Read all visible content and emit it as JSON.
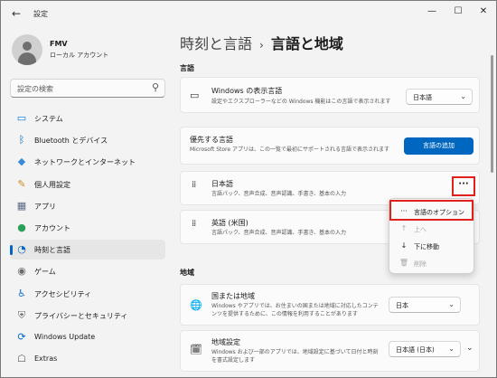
{
  "window": {
    "title": "設定"
  },
  "user": {
    "name": "FMV",
    "account": "ローカル アカウント"
  },
  "search": {
    "placeholder": "設定の検索"
  },
  "nav": [
    {
      "label": "システム",
      "icon": "monitor-icon",
      "color": "#0078d4"
    },
    {
      "label": "Bluetooth とデバイス",
      "icon": "bluetooth-icon",
      "color": "#0067c0"
    },
    {
      "label": "ネットワークとインターネット",
      "icon": "wifi-icon",
      "color": "#3a8bd6"
    },
    {
      "label": "個人用設定",
      "icon": "brush-icon",
      "color": "#d08a2a"
    },
    {
      "label": "アプリ",
      "icon": "apps-icon",
      "color": "#5a6b85"
    },
    {
      "label": "アカウント",
      "icon": "person-icon",
      "color": "#2aa05a"
    },
    {
      "label": "時刻と言語",
      "icon": "clock-globe-icon",
      "color": "#0067c0",
      "active": true
    },
    {
      "label": "ゲーム",
      "icon": "gamepad-icon",
      "color": "#6b6b6b"
    },
    {
      "label": "アクセシビリティ",
      "icon": "accessibility-icon",
      "color": "#1a73c8"
    },
    {
      "label": "プライバシーとセキュリティ",
      "icon": "shield-icon",
      "color": "#6b6b6b"
    },
    {
      "label": "Windows Update",
      "icon": "update-icon",
      "color": "#0067c0"
    },
    {
      "label": "Extras",
      "icon": "extras-icon",
      "color": "#555555"
    }
  ],
  "breadcrumb": {
    "parent": "時刻と言語",
    "separator": "›",
    "current": "言語と地域"
  },
  "language_section": {
    "title": "言語",
    "display_language": {
      "title": "Windows の表示言語",
      "desc": "設定やエクスプローラーなどの Windows 機能はこの言語で表示されます",
      "value": "日本語"
    },
    "preferred": {
      "title": "優先する言語",
      "desc": "Microsoft Store アプリは、この一覧で最初にサポートされる言語で表示されます",
      "button": "言語の追加"
    },
    "languages": [
      {
        "name": "日本語",
        "features": "言語パック、音声合成、音声認識、手書き、基本の入力"
      },
      {
        "name": "英語 (米国)",
        "features": "言語パック、音声合成、音声認識、手書き、基本の入力"
      }
    ],
    "more_label": "···"
  },
  "context_menu": [
    {
      "label": "言語のオプション",
      "icon": "more-icon",
      "glyph": "···",
      "disabled": false
    },
    {
      "label": "上へ",
      "icon": "arrow-up-icon",
      "glyph": "↑",
      "disabled": true
    },
    {
      "label": "下に移動",
      "icon": "arrow-down-icon",
      "glyph": "↓",
      "disabled": false
    },
    {
      "label": "削除",
      "icon": "trash-icon",
      "glyph": "🗑",
      "disabled": true
    }
  ],
  "region_section": {
    "title": "地域",
    "country": {
      "title": "国または地域",
      "desc": "Windows やアプリでは、お住まいの国または地域に対応したコンテンツを提供するために、この情報を利用することがあります",
      "value": "日本"
    },
    "format": {
      "title": "地域設定",
      "desc": "Windows および一部のアプリでは、地域設定に基づいて日付と時刻を書式設定します",
      "value": "日本語 (日本)"
    }
  }
}
